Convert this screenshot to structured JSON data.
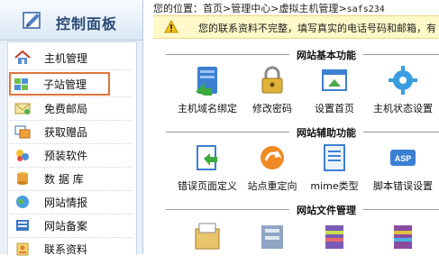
{
  "panel": {
    "title": "控制面板"
  },
  "nav": [
    {
      "label": "主机管理",
      "icon": "house-icon"
    },
    {
      "label": "子站管理",
      "icon": "subsite-icon",
      "active": true
    },
    {
      "label": "免费邮局",
      "icon": "envelope-icon"
    },
    {
      "label": "获取赠品",
      "icon": "gift-icon"
    },
    {
      "label": "预装软件",
      "icon": "software-icon"
    },
    {
      "label": "数 据 库",
      "icon": "database-icon"
    },
    {
      "label": "网站情报",
      "icon": "globe-icon"
    },
    {
      "label": "网站备案",
      "icon": "record-icon"
    },
    {
      "label": "联系资料",
      "icon": "contact-icon"
    }
  ],
  "breadcrumb": {
    "prefix": "您的位置：",
    "items": [
      "首页",
      "管理中心",
      "虚拟主机管理",
      "safs234"
    ],
    "sep": ">"
  },
  "notice": {
    "text": "您的联系资料不完整，填写真实的电话号码和邮箱，有"
  },
  "sections": [
    {
      "title": "网站基本功能",
      "items": [
        "主机域名绑定",
        "修改密码",
        "设置首页",
        "主机状态设置"
      ]
    },
    {
      "title": "网站辅助功能",
      "items": [
        "错误页面定义",
        "站点重定向",
        "mime类型",
        "脚本错误设置"
      ]
    },
    {
      "title": "网站文件管理",
      "items": [
        "",
        "",
        "",
        ""
      ]
    }
  ]
}
